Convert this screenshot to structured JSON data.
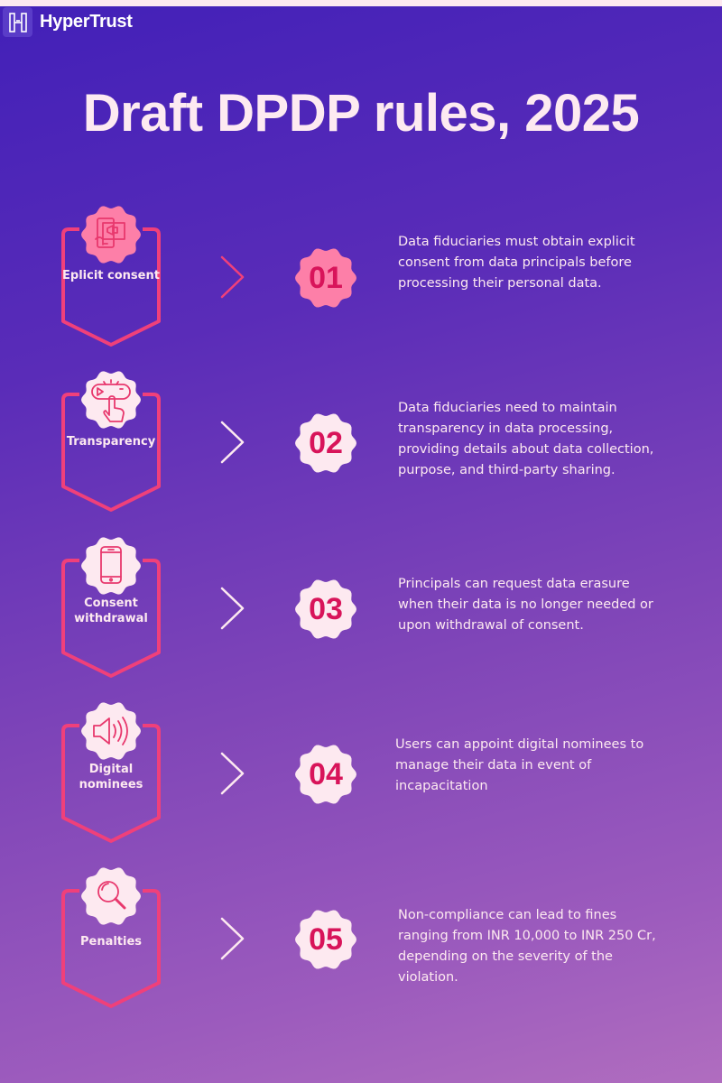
{
  "brand": {
    "name": "HyperTrust",
    "logo_icon": "h-logo-icon"
  },
  "title": "Draft DPDP rules, 2025",
  "colors": {
    "accent": "#f0407a",
    "number_text": "#d8145a",
    "badge_active": "#fd7fa8",
    "badge_default": "#fde9f0",
    "text_light": "#fde9f0"
  },
  "items": [
    {
      "number": "01",
      "label": "Eplicit consent",
      "icon": "consent-megaphone-icon",
      "active": true,
      "description": "Data fiduciaries must obtain explicit consent from data principals before processing their personal data."
    },
    {
      "number": "02",
      "label": "Transparency",
      "icon": "click-button-icon",
      "active": false,
      "description": "Data fiduciaries need to maintain transparency in data processing, providing details about data collection, purpose, and third-party sharing."
    },
    {
      "number": "03",
      "label": "Consent withdrawal",
      "icon": "smartphone-icon",
      "active": false,
      "description": "Principals can request data erasure when their data is no longer needed or upon withdrawal of consent."
    },
    {
      "number": "04",
      "label": "Digital nominees",
      "icon": "speaker-icon",
      "active": false,
      "description": "Users can appoint digital nominees to manage their data in event of incapacitation"
    },
    {
      "number": "05",
      "label": "Penalties",
      "icon": "magnifier-icon",
      "active": false,
      "description": "Non-compliance can lead to fines ranging from INR 10,000 to INR 250 Cr, depending on the severity of the violation."
    }
  ]
}
